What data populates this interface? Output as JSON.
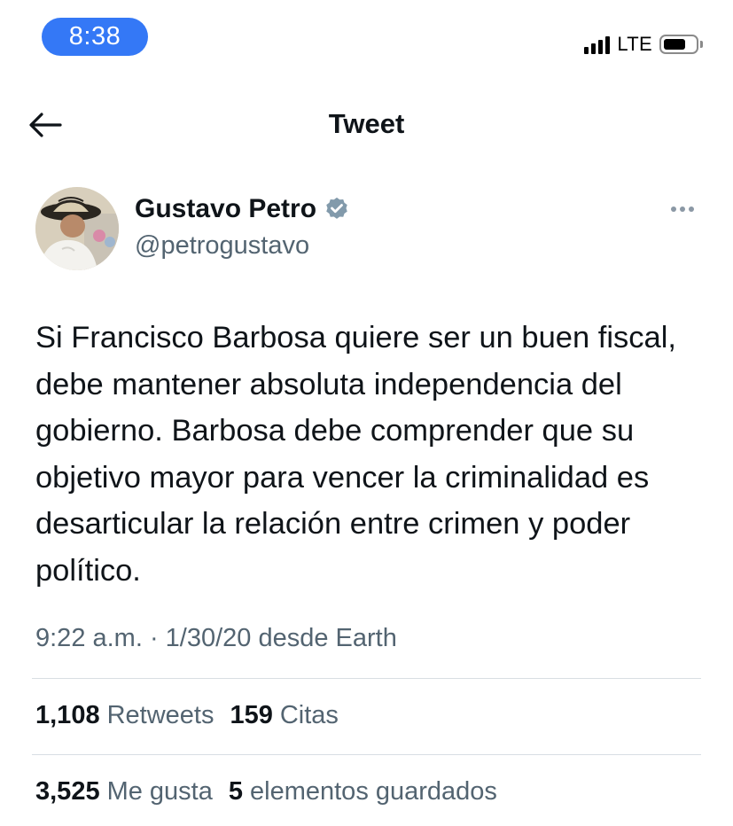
{
  "status_bar": {
    "time": "8:38",
    "network": "LTE",
    "signal_bars": 4,
    "battery_level": 0.7
  },
  "header": {
    "back_icon": "arrow-left-icon",
    "title": "Tweet"
  },
  "author": {
    "name": "Gustavo Petro",
    "handle": "@petrogustavo",
    "verified_icon": "verified-badge-icon",
    "more_icon": "more-horizontal-icon"
  },
  "tweet": {
    "text": "Si Francisco Barbosa quiere ser un buen fiscal, debe mantener absoluta independencia del gobierno. Barbosa debe comprender que su objetivo mayor para vencer la criminalidad es desarticular la relación entre crimen y poder político.",
    "meta": "9:22 a.m. · 1/30/20 desde Earth"
  },
  "stats": {
    "retweets_count": "1,108",
    "retweets_label": "Retweets",
    "quotes_count": "159",
    "quotes_label": "Citas",
    "likes_count": "3,525",
    "likes_label": "Me gusta",
    "bookmarks_count": "5",
    "bookmarks_label": "elementos guardados"
  },
  "colors": {
    "accent": "#3478f6",
    "text_primary": "#0f1419",
    "text_secondary": "#536471",
    "verified": "#829aab",
    "divider": "#d8dee3"
  }
}
